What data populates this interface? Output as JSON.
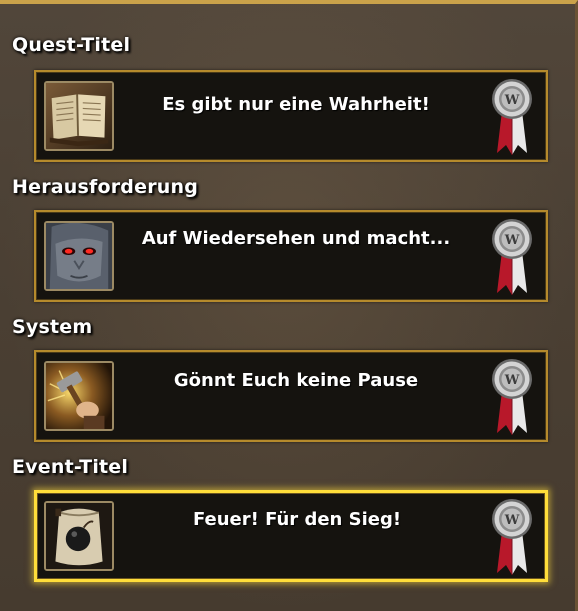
{
  "sections": [
    {
      "heading": "Quest-Titel",
      "card_label": "Es gibt nur eine Wahrheit!",
      "icon": "book-icon",
      "medal_icon": "medal-icon",
      "selected": false
    },
    {
      "heading": "Herausforderung",
      "card_label": "Auf Wiedersehen und macht...",
      "icon": "red-eyed-face-icon",
      "medal_icon": "medal-icon",
      "selected": false
    },
    {
      "heading": "System",
      "card_label": "Gönnt Euch keine Pause",
      "icon": "hammer-icon",
      "medal_icon": "medal-icon",
      "selected": false
    },
    {
      "heading": "Event-Titel",
      "card_label": "Feuer! Für den Sieg!",
      "icon": "cannonball-sack-icon",
      "medal_icon": "medal-icon",
      "selected": true
    }
  ],
  "colors": {
    "background": "#4a3f33",
    "card_background": "#15130f",
    "card_border": "#b58a2c",
    "selected_border": "#ffde3a",
    "text": "#ffffff"
  }
}
